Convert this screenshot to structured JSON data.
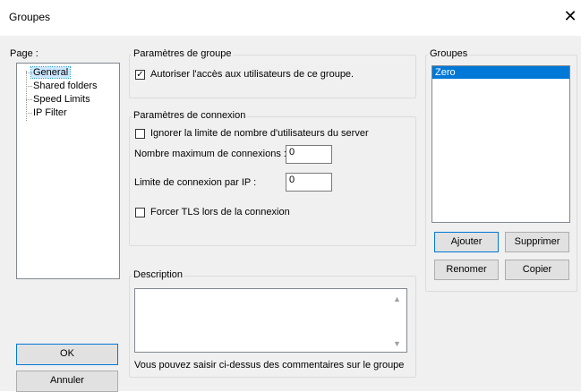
{
  "window": {
    "title": "Groupes",
    "close_glyph": "✕"
  },
  "page_panel": {
    "label": "Page :",
    "items": [
      {
        "label": "General",
        "selected": true
      },
      {
        "label": "Shared folders",
        "selected": false
      },
      {
        "label": "Speed Limits",
        "selected": false
      },
      {
        "label": "IP Filter",
        "selected": false
      }
    ]
  },
  "group_params": {
    "legend": "Paramètres de groupe",
    "allow_access": {
      "label": "Autoriser l'accès aux utilisateurs de ce groupe.",
      "checked": true
    }
  },
  "connection_params": {
    "legend": "Paramètres de connexion",
    "ignore_limit": {
      "label": "Ignorer la limite de nombre d'utilisateurs du server",
      "checked": false
    },
    "max_connections": {
      "label": "Nombre maximum de connexions :",
      "value": "0"
    },
    "limit_per_ip": {
      "label": "Limite de connexion par IP :",
      "value": "0"
    },
    "force_tls": {
      "label": "Forcer TLS lors de la connexion",
      "checked": false
    }
  },
  "description": {
    "legend": "Description",
    "value": "",
    "hint": "Vous pouvez saisir ci-dessus des commentaires sur le groupe"
  },
  "groups": {
    "legend": "Groupes",
    "items": [
      {
        "label": "Zero",
        "selected": true
      }
    ],
    "add_label": "Ajouter",
    "delete_label": "Supprimer",
    "rename_label": "Renomer",
    "copy_label": "Copier"
  },
  "buttons": {
    "ok_label": "OK",
    "cancel_label": "Annuler"
  },
  "icons": {
    "checkmark": "✓",
    "scroll_up": "▲",
    "scroll_down": "▼"
  }
}
